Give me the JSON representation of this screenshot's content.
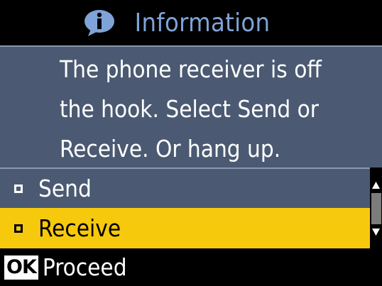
{
  "header": {
    "icon": "info-icon",
    "title": "Information"
  },
  "message": {
    "lines": [
      "The phone receiver is off",
      "the hook. Select Send or",
      "Receive. Or hang up."
    ]
  },
  "options": [
    {
      "label": "Send",
      "selected": false
    },
    {
      "label": "Receive",
      "selected": true
    }
  ],
  "footer": {
    "button_label": "OK",
    "action_label": "Proceed"
  },
  "colors": {
    "background": "#000000",
    "panel": "#4b5a72",
    "title": "#7fa3d8",
    "highlight": "#f7c90c",
    "text": "#ffffff"
  }
}
